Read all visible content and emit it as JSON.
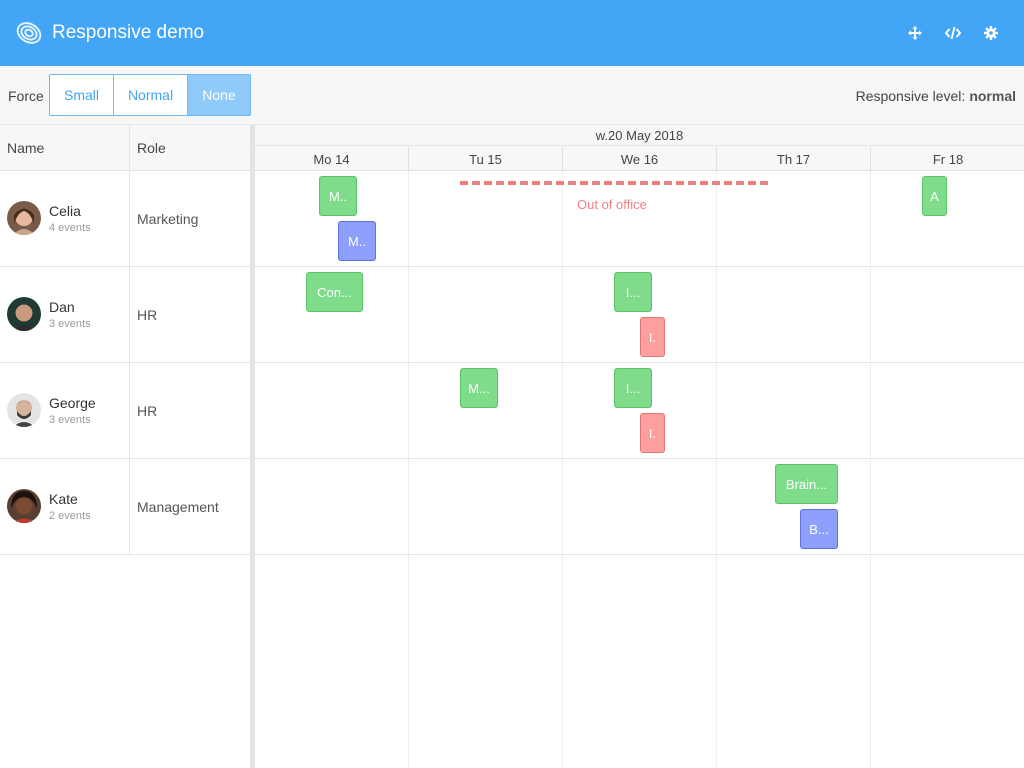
{
  "app": {
    "title": "Responsive demo",
    "accent_color": "#42a5f5",
    "header_buttons": [
      "fullscreen-icon",
      "code-icon",
      "settings-icon"
    ]
  },
  "toolbar": {
    "force_label": "Force",
    "buttons": [
      {
        "label": "Small",
        "active": false
      },
      {
        "label": "Normal",
        "active": false
      },
      {
        "label": "None",
        "active": true
      }
    ],
    "responsive_label": "Responsive level:",
    "responsive_value": "normal"
  },
  "grid": {
    "columns": [
      "Name",
      "Role"
    ]
  },
  "timeline": {
    "week": "w.20 May 2018",
    "days": [
      "Mo 14",
      "Tu 15",
      "We 16",
      "Th 17",
      "Fr 18"
    ]
  },
  "resources": [
    {
      "name": "Celia",
      "events": "4 events",
      "role": "Marketing"
    },
    {
      "name": "Dan",
      "events": "3 events",
      "role": "HR"
    },
    {
      "name": "George",
      "events": "3 events",
      "role": "HR"
    },
    {
      "name": "Kate",
      "events": "2 events",
      "role": "Management"
    }
  ],
  "events": [
    {
      "label": "M..",
      "color": "green"
    },
    {
      "label": "M..",
      "color": "blue"
    },
    {
      "label": "A",
      "color": "green"
    },
    {
      "label": "Con...",
      "color": "green"
    },
    {
      "label": "I...",
      "color": "green"
    },
    {
      "label": "I.",
      "color": "red"
    },
    {
      "label": "M...",
      "color": "green"
    },
    {
      "label": "I...",
      "color": "green"
    },
    {
      "label": "I.",
      "color": "red"
    },
    {
      "label": "Brain...",
      "color": "green"
    },
    {
      "label": "B...",
      "color": "blue"
    }
  ],
  "out_of_office": {
    "label": "Out of office",
    "color": "#ef7f80"
  }
}
